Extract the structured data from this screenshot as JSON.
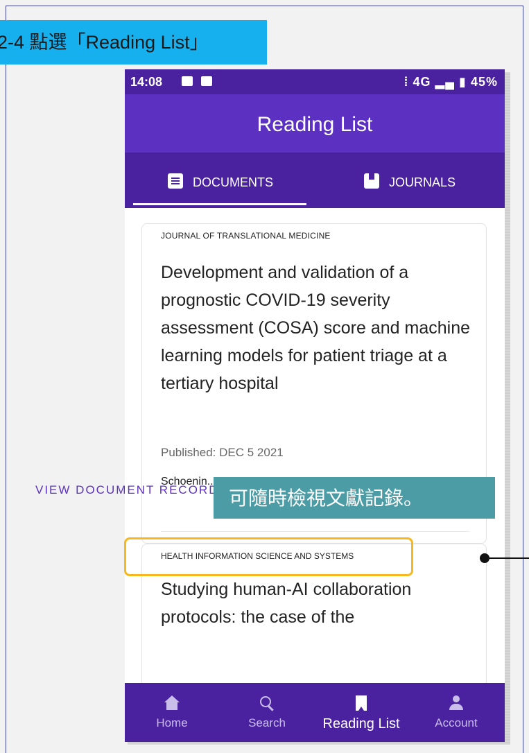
{
  "instruction": {
    "banner_text": "2-4 點選「Reading List」",
    "callout_text": "可隨時檢視文獻記錄。"
  },
  "status_bar": {
    "time": "14:08",
    "right_indicators": "⁞ 4G ▂▄ ▮ 45%",
    "battery": "45%"
  },
  "app_bar": {
    "title": "Reading List"
  },
  "tabs": [
    {
      "label": "DOCUMENTS",
      "icon": "document-icon",
      "selected": true
    },
    {
      "label": "JOURNALS",
      "icon": "journal-icon",
      "selected": false
    }
  ],
  "documents": [
    {
      "journal": "JOURNAL OF TRANSLATIONAL MEDICINE",
      "title": "Development and validation of a prognostic COVID-19 severity assessment (COSA) score and machine learning models for patient triage at a tertiary hospital",
      "published": "Published: DEC 5 2021",
      "authors": "Schoenin... Baumgar...",
      "action_label": "VIEW DOCUMENT RECORD",
      "more_label": "•••"
    },
    {
      "journal": "HEALTH INFORMATION SCIENCE AND SYSTEMS",
      "title": "Studying human-AI collaboration protocols: the case of the"
    }
  ],
  "bottom_nav": [
    {
      "label": "Home",
      "icon": "home-icon"
    },
    {
      "label": "Search",
      "icon": "search-icon"
    },
    {
      "label": "Reading List",
      "icon": "bookmark-icon",
      "active": true
    },
    {
      "label": "Account",
      "icon": "account-icon"
    }
  ],
  "colors": {
    "primary_dark": "#4a22a0",
    "primary": "#5c31c1",
    "banner": "#16b0ef",
    "callout": "#4c9ca6",
    "highlight": "#f6b81d"
  }
}
